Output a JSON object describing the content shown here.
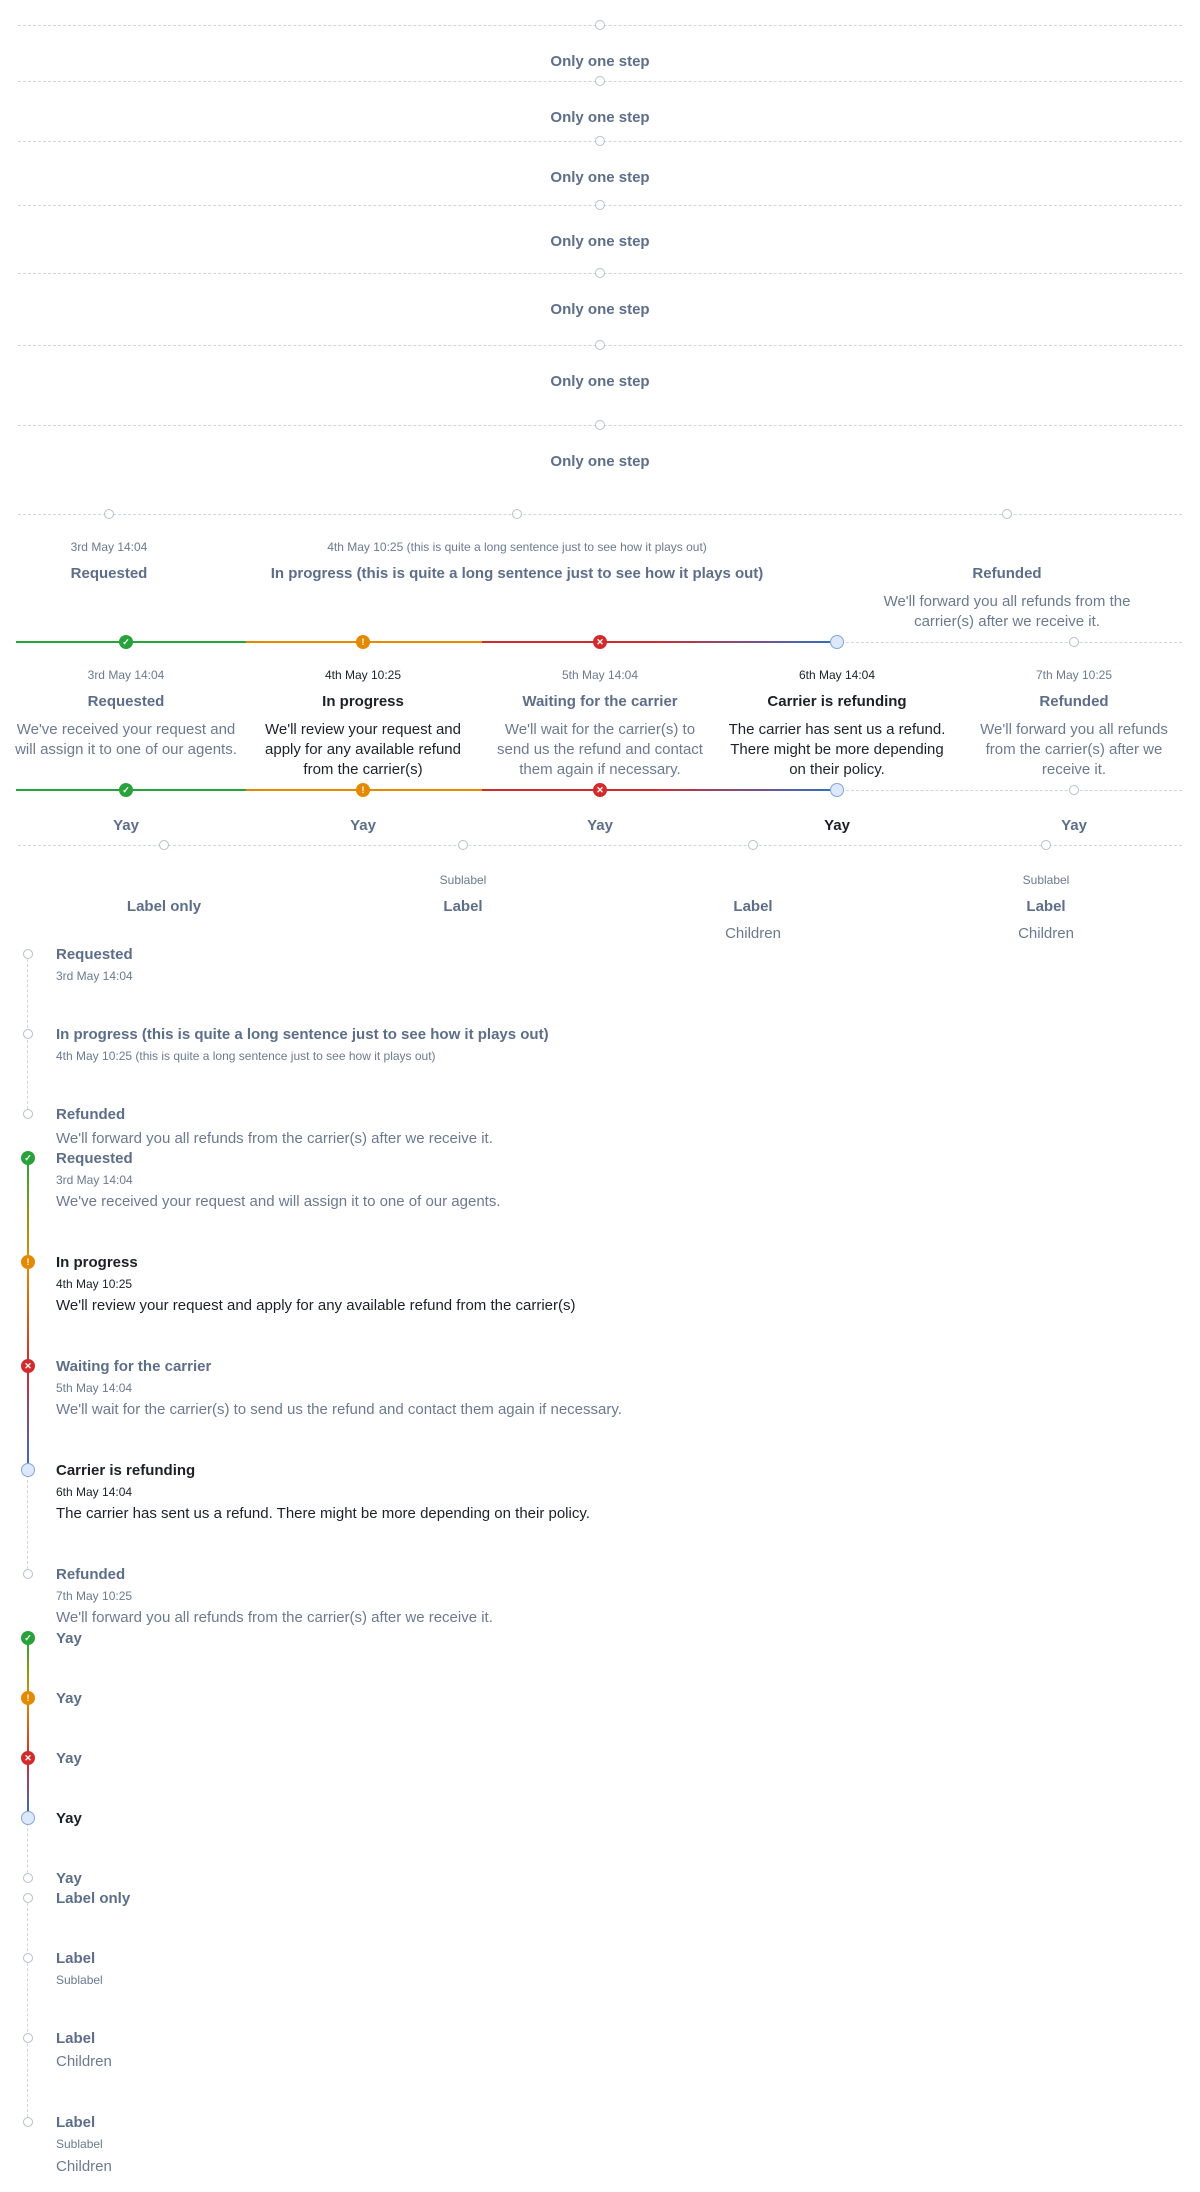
{
  "single_steps": [
    "Only one step",
    "Only one step",
    "Only one step",
    "Only one step",
    "Only one step",
    "Only one step",
    "Only one step"
  ],
  "h_plain": {
    "steps": [
      {
        "date": "3rd May 14:04",
        "label": "Requested",
        "desc": ""
      },
      {
        "date": "4th May 10:25 (this is quite a long sentence just to see how it plays out)",
        "label": "In progress (this is quite a long sentence just to see how it plays out)",
        "desc": ""
      },
      {
        "date": "",
        "label": "Refunded",
        "desc": "We'll forward you all refunds from the carrier(s) after we receive it."
      }
    ]
  },
  "h_status": {
    "steps": [
      {
        "status": "success",
        "date": "3rd May 14:04",
        "label": "Requested",
        "desc": "We've received your request and will assign it to one of our agents."
      },
      {
        "status": "warning",
        "date": "4th May 10:25",
        "label": "In progress",
        "desc": "We'll review your request and apply for any available refund from the carrier(s)"
      },
      {
        "status": "critical",
        "date": "5th May 14:04",
        "label": "Waiting for the carrier",
        "desc": "We'll wait for the carrier(s) to send us the refund and contact them again if necessary."
      },
      {
        "status": "info",
        "date": "6th May 14:04",
        "label": "Carrier is refunding",
        "desc": "The carrier has sent us a refund. There might be more depending on their policy."
      },
      {
        "status": "none",
        "date": "7th May 10:25",
        "label": "Refunded",
        "desc": "We'll forward you all refunds from the carrier(s) after we receive it."
      }
    ]
  },
  "h_yay": {
    "steps": [
      {
        "status": "success",
        "label": "Yay"
      },
      {
        "status": "warning",
        "label": "Yay"
      },
      {
        "status": "critical",
        "label": "Yay"
      },
      {
        "status": "info",
        "label": "Yay"
      },
      {
        "status": "none",
        "label": "Yay"
      }
    ]
  },
  "h_labels": {
    "steps": [
      {
        "sublabel": "",
        "label": "Label only",
        "children": ""
      },
      {
        "sublabel": "Sublabel",
        "label": "Label",
        "children": ""
      },
      {
        "sublabel": "",
        "label": "Label",
        "children": "Children"
      },
      {
        "sublabel": "Sublabel",
        "label": "Label",
        "children": "Children"
      }
    ]
  },
  "v_plain": {
    "steps": [
      {
        "label": "Requested",
        "date": "3rd May 14:04",
        "desc": ""
      },
      {
        "label": "In progress (this is quite a long sentence just to see how it plays out)",
        "date": "4th May 10:25 (this is quite a long sentence just to see how it plays out)",
        "desc": ""
      },
      {
        "label": "Refunded",
        "date": "",
        "desc": "We'll forward you all refunds from the carrier(s) after we receive it."
      }
    ]
  },
  "v_status": {
    "steps": [
      {
        "status": "success",
        "label": "Requested",
        "date": "3rd May 14:04",
        "desc": "We've received your request and will assign it to one of our agents."
      },
      {
        "status": "warning",
        "label": "In progress",
        "date": "4th May 10:25",
        "desc": "We'll review your request and apply for any available refund from the carrier(s)"
      },
      {
        "status": "critical",
        "label": "Waiting for the carrier",
        "date": "5th May 14:04",
        "desc": "We'll wait for the carrier(s) to send us the refund and contact them again if necessary."
      },
      {
        "status": "info",
        "label": "Carrier is refunding",
        "date": "6th May 14:04",
        "desc": "The carrier has sent us a refund. There might be more depending on their policy."
      },
      {
        "status": "none",
        "label": "Refunded",
        "date": "7th May 10:25",
        "desc": "We'll forward you all refunds from the carrier(s) after we receive it."
      }
    ]
  },
  "v_yay": {
    "steps": [
      {
        "status": "success",
        "label": "Yay"
      },
      {
        "status": "warning",
        "label": "Yay"
      },
      {
        "status": "critical",
        "label": "Yay"
      },
      {
        "status": "info",
        "label": "Yay"
      },
      {
        "status": "none",
        "label": "Yay"
      }
    ]
  },
  "v_labels": {
    "steps": [
      {
        "label": "Label only",
        "sublabel": "",
        "children": ""
      },
      {
        "label": "Label",
        "sublabel": "Sublabel",
        "children": ""
      },
      {
        "label": "Label",
        "sublabel": "",
        "children": "Children"
      },
      {
        "label": "Label",
        "sublabel": "Sublabel",
        "children": "Children"
      }
    ]
  },
  "colors": {
    "success": "#28a23a",
    "warning": "#e58a00",
    "critical": "#d32b2b",
    "info": "#2f6fd0",
    "muted": "#5d6e8b",
    "active": "#1c2129"
  },
  "icons": {
    "success": "check-icon",
    "warning": "exclamation-icon",
    "critical": "close-icon",
    "info": "ring-icon",
    "none": "empty-circle-icon"
  }
}
